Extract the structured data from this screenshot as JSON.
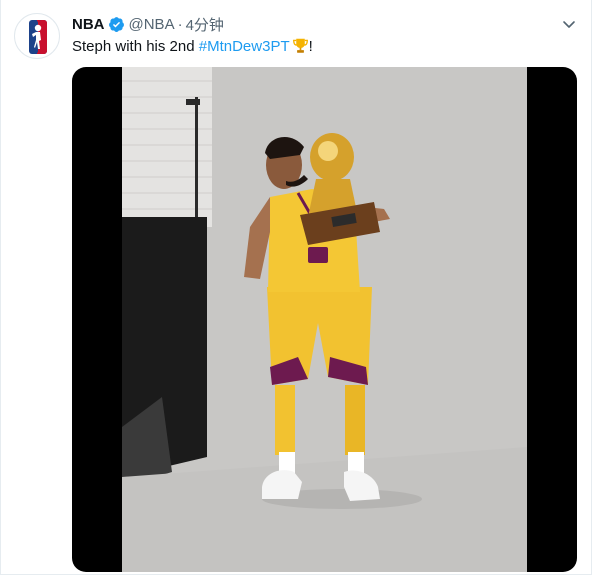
{
  "tweet": {
    "display_name": "NBA",
    "handle": "@NBA",
    "separator": "·",
    "timestamp": "4分钟",
    "text_prefix": "Steph with his 2nd ",
    "hashtag": "#MtnDew3PT",
    "text_suffix": "!",
    "emoji": "trophy-icon"
  },
  "colors": {
    "link": "#1d9bf0",
    "verified": "#1d9bf0",
    "text": "#0f1419",
    "secondary": "#536471",
    "jersey": "#f2c230"
  }
}
